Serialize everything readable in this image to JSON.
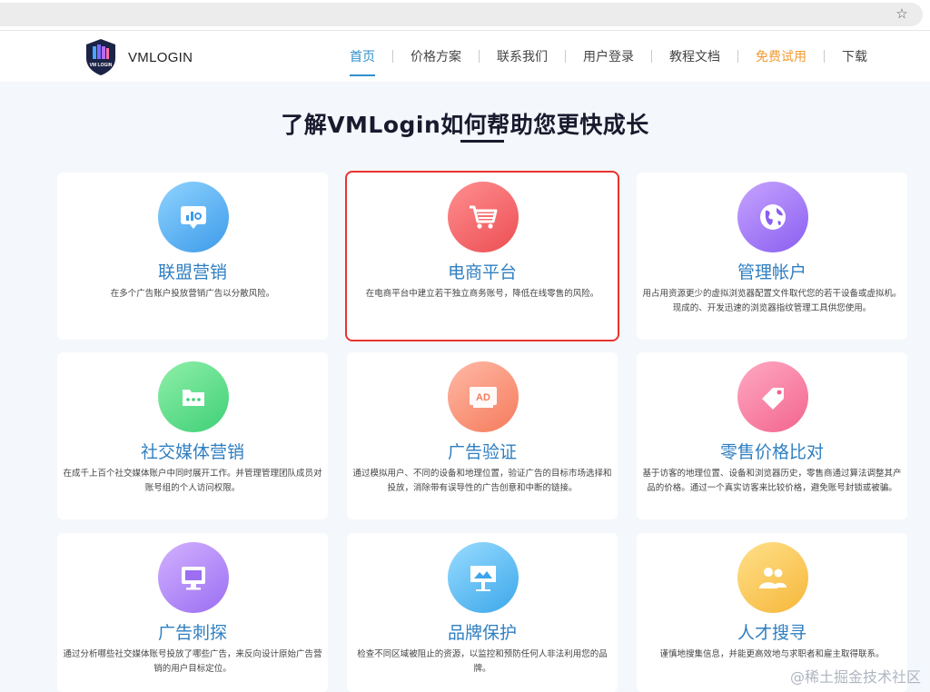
{
  "browser": {
    "bookmark_icon": "star-icon"
  },
  "header": {
    "logo_text": "VMLOGIN",
    "logo_badge": "VM LOGIN",
    "nav": [
      {
        "label": "首页",
        "state": "active"
      },
      {
        "label": "价格方案",
        "state": ""
      },
      {
        "label": "联系我们",
        "state": ""
      },
      {
        "label": "用户登录",
        "state": ""
      },
      {
        "label": "教程文档",
        "state": ""
      },
      {
        "label": "免费试用",
        "state": "highlight"
      },
      {
        "label": "下载",
        "state": ""
      }
    ]
  },
  "section": {
    "title": "了解VMLogin如何帮助您更快成长"
  },
  "cards": [
    {
      "title": "联盟营销",
      "desc": "在多个广告账户投放营销广告以分散风险。",
      "icon": "presentation-chart-icon",
      "color": "#3d9be9"
    },
    {
      "title": "电商平台",
      "desc": "在电商平台中建立若干独立商务账号，降低在线零售的风险。",
      "icon": "shopping-cart-icon",
      "color": "#ec4e54",
      "selected": true
    },
    {
      "title": "管理帐户",
      "desc": "用占用资源更少的虚拟浏览器配置文件取代您的若干设备或虚拟机。现成的、开发迅速的浏览器指纹管理工具供您使用。",
      "icon": "globe-icon",
      "color": "#8a5ef0"
    },
    {
      "title": "社交媒体营销",
      "desc": "在成千上百个社交媒体账户中同时展开工作。并管理管理团队成员对账号组的个人访问权限。",
      "icon": "folder-chat-icon",
      "color": "#3fcf76"
    },
    {
      "title": "广告验证",
      "desc": "通过模拟用户、不同的设备和地理位置，验证广告的目标市场选择和投放，消除带有误导性的广告创意和中断的链接。",
      "icon": "ad-icon",
      "color": "#f57b5c",
      "icon_text": "AD"
    },
    {
      "title": "零售价格比对",
      "desc": "基于访客的地理位置、设备和浏览器历史，零售商通过算法调整其产品的价格。通过一个真实访客来比较价格，避免账号封锁或被骗。",
      "icon": "price-tag-icon",
      "color": "#f2648e"
    },
    {
      "title": "广告刺探",
      "desc": "通过分析哪些社交媒体账号投放了哪些广告，来反向设计原始广告营销的用户目标定位。",
      "icon": "monitor-icon",
      "color": "#9b6ef2"
    },
    {
      "title": "品牌保护",
      "desc": "检查不同区域被阻止的资源，以监控和预防任何人非法利用您的品牌。",
      "icon": "billboard-icon",
      "color": "#3ca7ea"
    },
    {
      "title": "人才搜寻",
      "desc": "谨慎地搜集信息，并能更高效地与求职者和雇主取得联系。",
      "icon": "people-icon",
      "color": "#f6b73a"
    }
  ],
  "watermark": "@稀土掘金技术社区"
}
